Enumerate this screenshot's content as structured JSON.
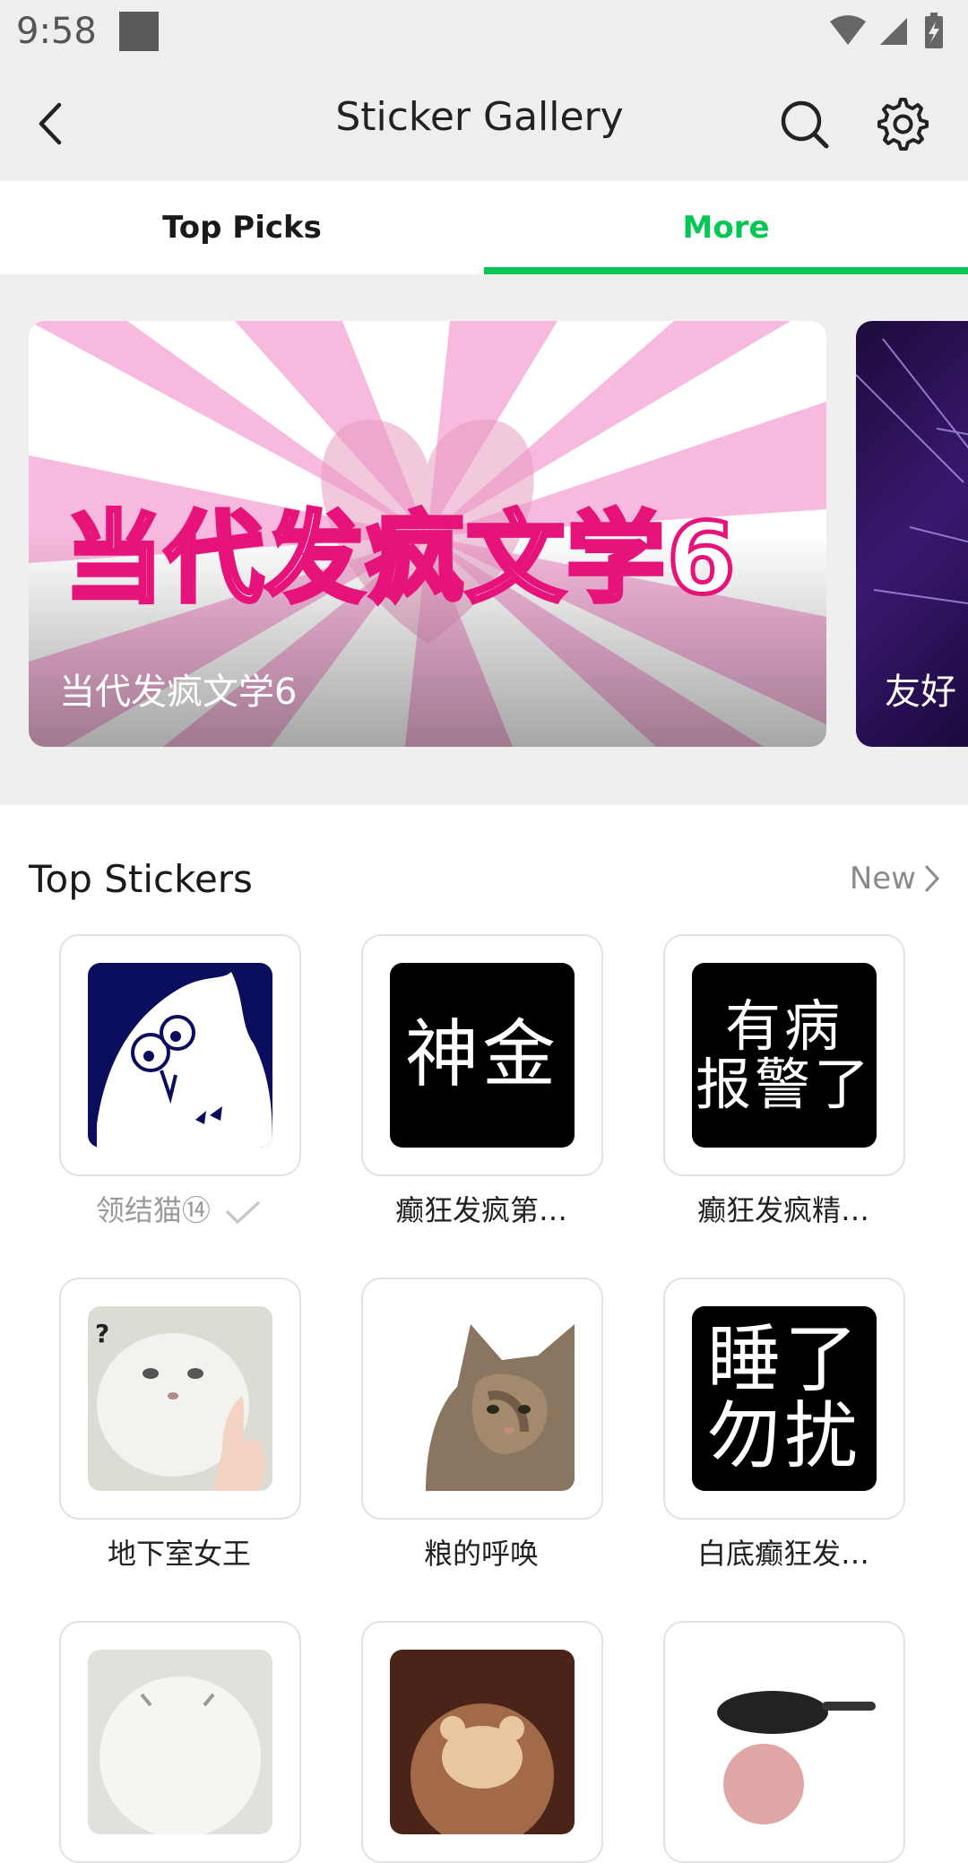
{
  "status_bar": {
    "time": "9:58"
  },
  "app_bar": {
    "title": "Sticker Gallery"
  },
  "tabs": [
    {
      "label": "Top Picks"
    },
    {
      "label": "More"
    }
  ],
  "banners": [
    {
      "title_art": "当代发疯文学6",
      "caption": "当代发疯文学6"
    },
    {
      "caption": "友好"
    }
  ],
  "section": {
    "title": "Top Stickers",
    "link_label": "New"
  },
  "stickers": [
    {
      "name": "领结猫⑭",
      "image_text": ""
    },
    {
      "name": "癫狂发疯第…",
      "image_text": "神金"
    },
    {
      "name": "癫狂发疯精…",
      "image_text_line1": "有病",
      "image_text_line2": "报警了"
    },
    {
      "name": "地下室女王"
    },
    {
      "name": "粮的呼唤"
    },
    {
      "name": "白底癫狂发…",
      "image_text_line1": "睡了",
      "image_text_line2": "勿扰"
    }
  ],
  "colors": {
    "accent": "#06c755",
    "banner_pink": "#f7b9dd",
    "text_muted": "#8a8a8a"
  }
}
